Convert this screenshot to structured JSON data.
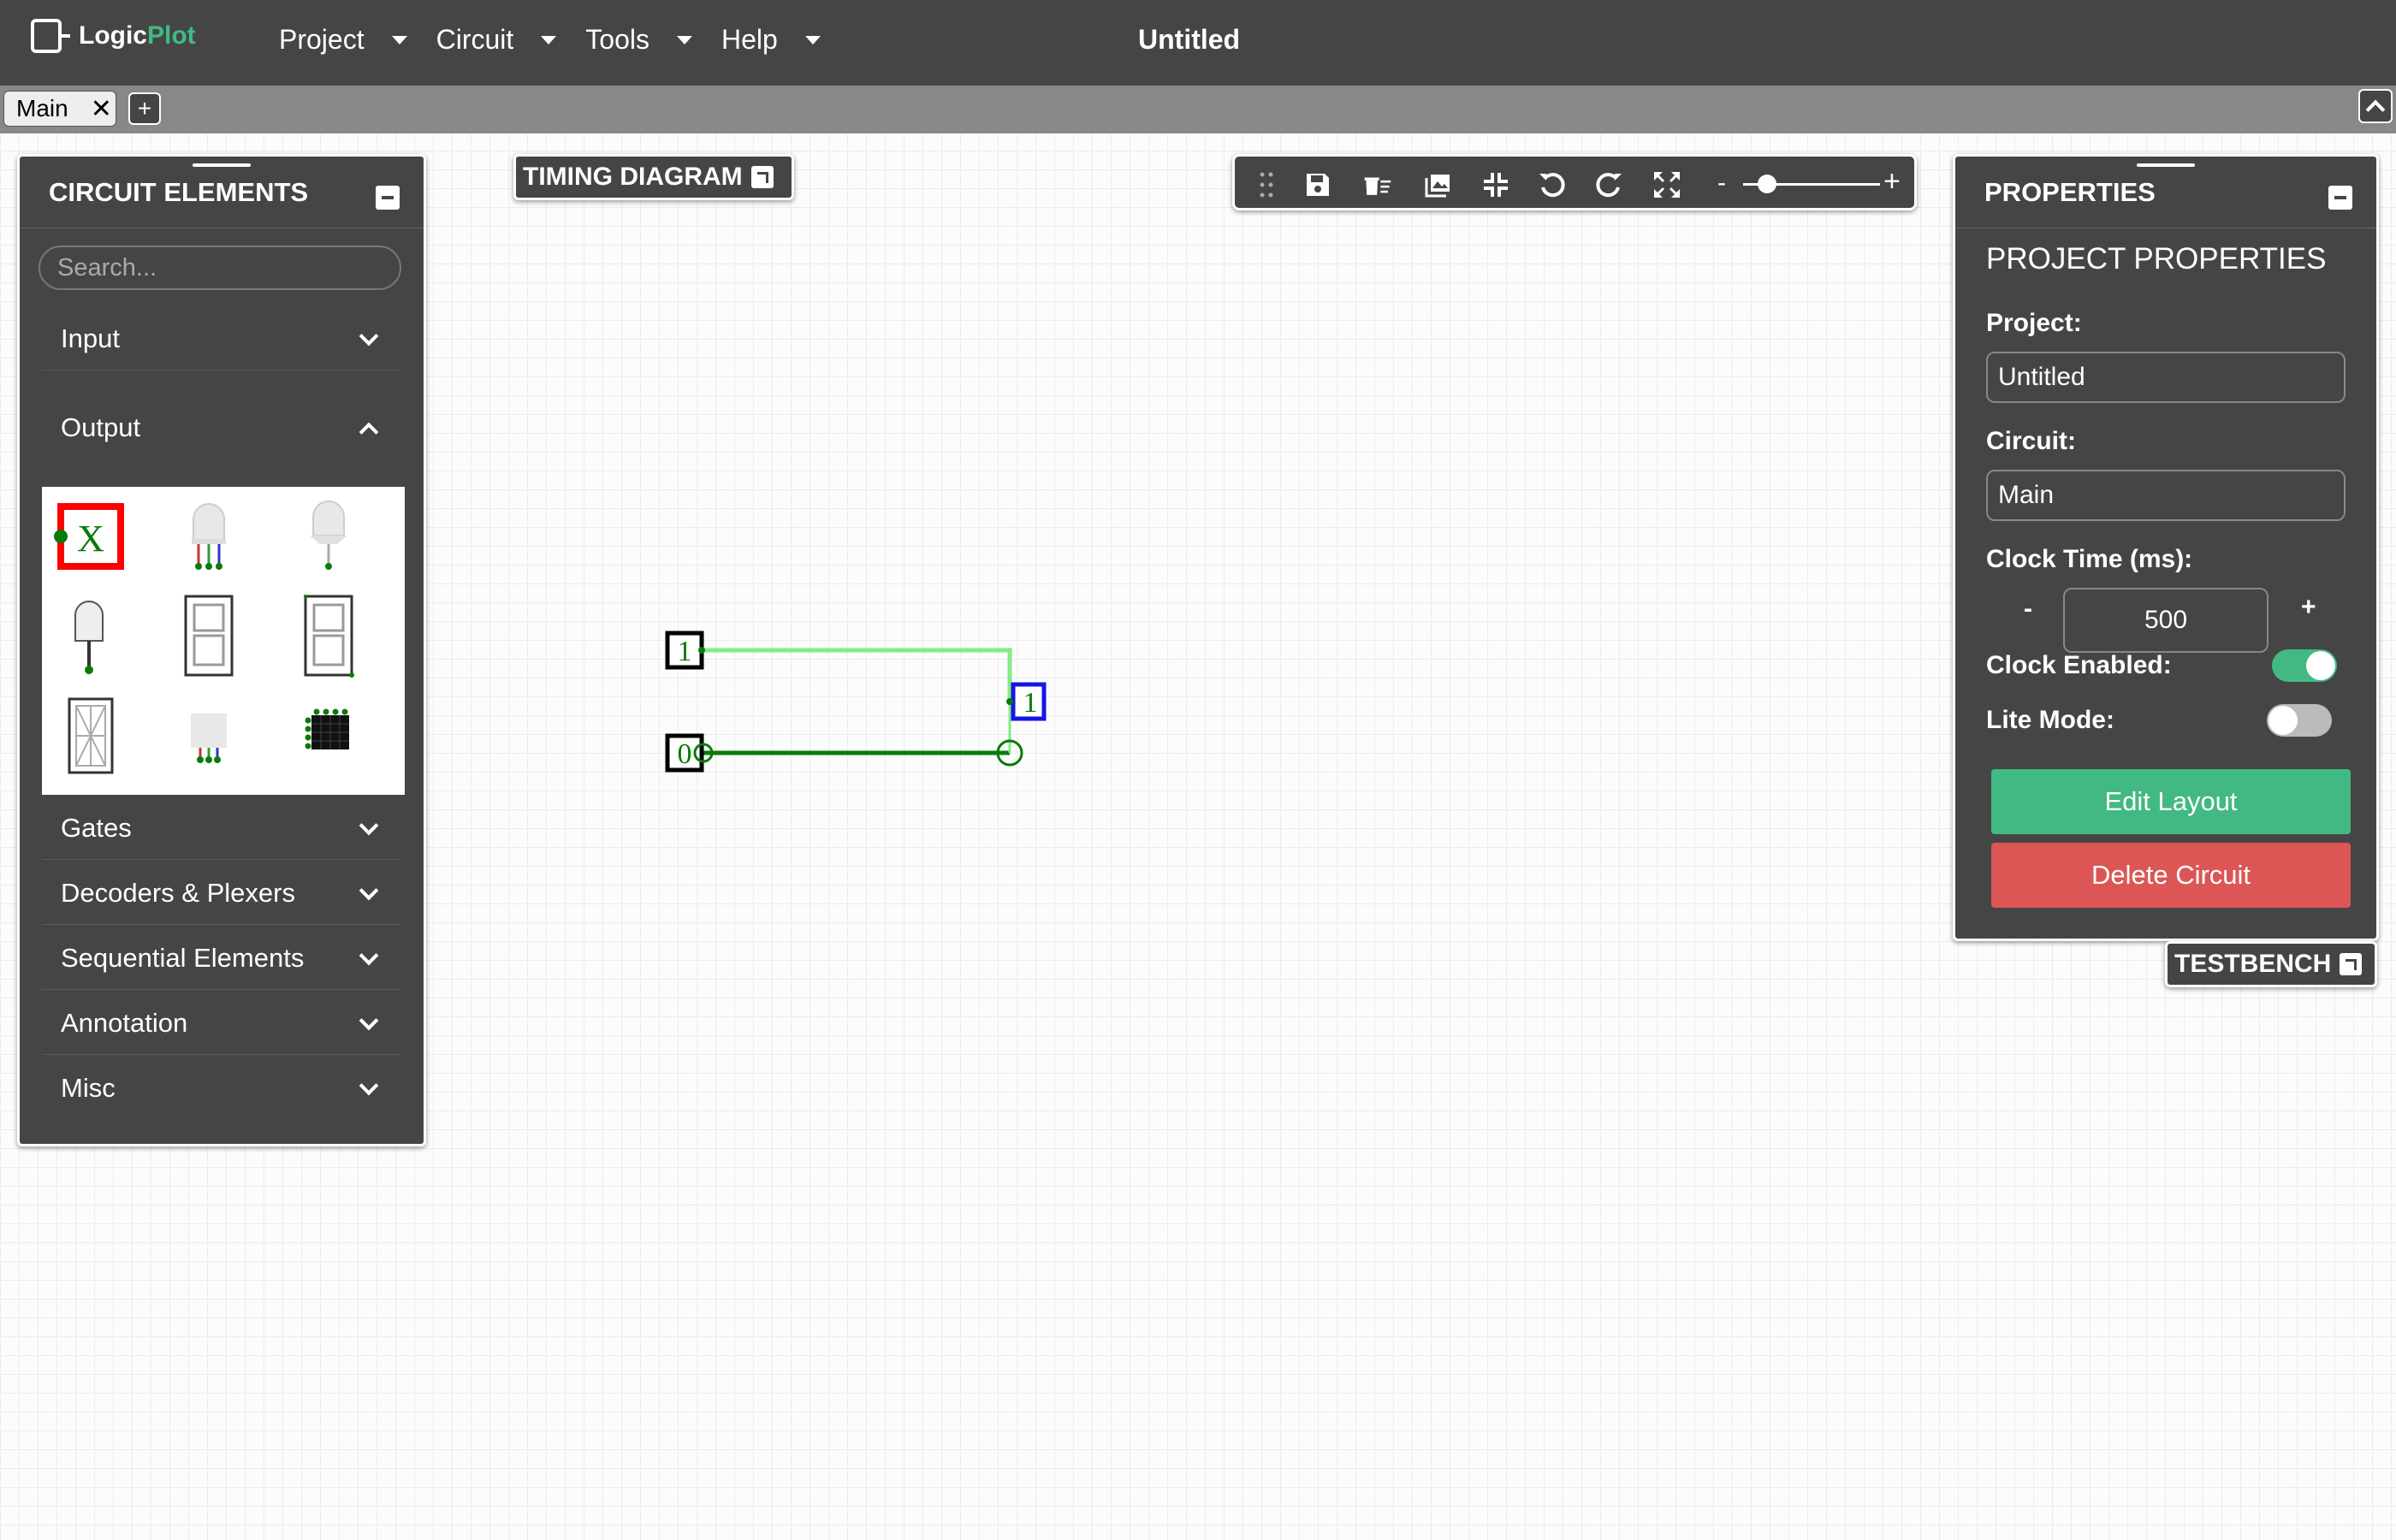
{
  "app": {
    "brand_a": "Logic",
    "brand_b": "Plot",
    "title": "Untitled"
  },
  "menu": [
    {
      "label": "Project"
    },
    {
      "label": "Circuit"
    },
    {
      "label": "Tools"
    },
    {
      "label": "Help"
    }
  ],
  "tabs": [
    {
      "label": "Main",
      "close": "✕"
    }
  ],
  "tab_add": "+",
  "circuit_elements": {
    "title": "CIRCUIT ELEMENTS",
    "search_placeholder": "Search...",
    "categories": [
      {
        "label": "Input",
        "expanded": false
      },
      {
        "label": "Output",
        "expanded": true
      },
      {
        "label": "Gates",
        "expanded": false
      },
      {
        "label": "Decoders & Plexers",
        "expanded": false
      },
      {
        "label": "Sequential Elements",
        "expanded": false
      },
      {
        "label": "Annotation",
        "expanded": false
      },
      {
        "label": "Misc",
        "expanded": false
      }
    ],
    "output_icons": [
      "output-probe-icon",
      "rgb-led-icon",
      "digital-led-icon",
      "variable-led-icon",
      "seven-segment-display-icon",
      "six-segment-display-icon",
      "sixteen-segment-display-icon",
      "square-rgb-led-icon",
      "rgb-led-matrix-icon"
    ],
    "probe_symbol": "X"
  },
  "timing_diagram": {
    "label": "TIMING DIAGRAM"
  },
  "testbench": {
    "label": "TESTBENCH"
  },
  "toolbar": {
    "icons": [
      "drag-handle-icon",
      "save-icon",
      "delete-icon",
      "image-icon",
      "fit-icon",
      "undo-icon",
      "redo-icon",
      "fullscreen-icon"
    ],
    "zoom_minus": "-",
    "zoom_plus": "+",
    "zoom_level": 0.1
  },
  "properties": {
    "title": "PROPERTIES",
    "section": "PROJECT PROPERTIES",
    "project_label": "Project:",
    "project_value": "Untitled",
    "circuit_label": "Circuit:",
    "circuit_value": "Main",
    "clock_label": "Clock Time (ms):",
    "clock_minus": "-",
    "clock_value": "500",
    "clock_plus": "+",
    "clock_enabled_label": "Clock Enabled:",
    "clock_enabled": true,
    "lite_mode_label": "Lite Mode:",
    "lite_mode": false,
    "edit_layout": "Edit Layout",
    "delete_circuit": "Delete Circuit"
  },
  "circuit": {
    "input_top_value": "1",
    "input_bottom_value": "0",
    "output_value": "1"
  },
  "colors": {
    "accent": "#42b983",
    "danger": "#dc5656",
    "panel": "#454545",
    "wire_on": "#84ec84",
    "wire_off": "#0a7a0a",
    "output_border": "#1515e6"
  }
}
